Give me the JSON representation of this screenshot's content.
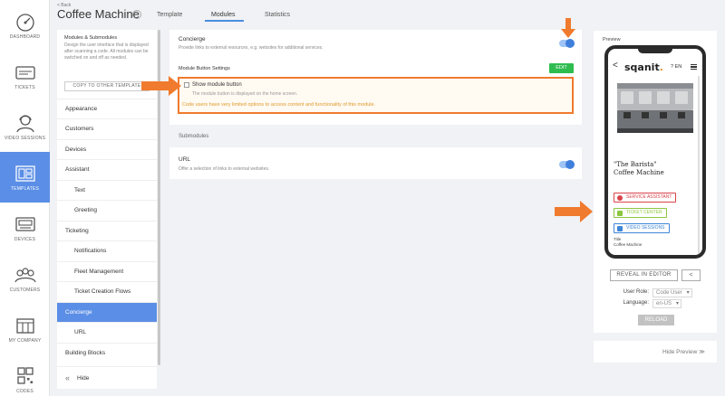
{
  "rail": [
    {
      "label": "DASHBOARD",
      "icon": "dashboard-icon"
    },
    {
      "label": "TICKETS",
      "icon": "tickets-icon"
    },
    {
      "label": "VIDEO SESSIONS",
      "icon": "video-sessions-icon"
    },
    {
      "label": "TEMPLATES",
      "icon": "templates-icon"
    },
    {
      "label": "DEVICES",
      "icon": "devices-icon"
    },
    {
      "label": "CUSTOMERS",
      "icon": "customers-icon"
    },
    {
      "label": "MY COMPANY",
      "icon": "company-icon"
    },
    {
      "label": "CODES",
      "icon": "codes-icon"
    }
  ],
  "header": {
    "back": "< Back",
    "title": "Coffee Machine",
    "info": "i",
    "tabs": [
      {
        "label": "Template"
      },
      {
        "label": "Modules"
      },
      {
        "label": "Statistics"
      }
    ]
  },
  "menu": {
    "heading": "Modules & Submodules",
    "description": "Design the user interface that is displayed after scanning a code. All modules can be switched on and off as needed.",
    "copy_button": "COPY TO OTHER TEMPLATE",
    "items": [
      {
        "label": "Appearance"
      },
      {
        "label": "Customers"
      },
      {
        "label": "Devices"
      },
      {
        "label": "Assistant"
      },
      {
        "label": "Text"
      },
      {
        "label": "Greeting"
      },
      {
        "label": "Ticketing"
      },
      {
        "label": "Notifications"
      },
      {
        "label": "Fleet Management"
      },
      {
        "label": "Ticket Creation Flows"
      },
      {
        "label": "Concierge"
      },
      {
        "label": "URL"
      },
      {
        "label": "Building Blocks"
      }
    ],
    "hide": "Hide"
  },
  "concierge": {
    "title": "Concierge",
    "description": "Provide links to external resources, e.g. websites for additional services.",
    "enabled": true,
    "settings_title": "Module Button Settings",
    "edit": "EDIT",
    "checkbox_label": "Show module button",
    "checkbox_sub": "The module button is displayed on the home screen.",
    "checked": false,
    "warning": "Code users have very limited options to access content and functionality of this module."
  },
  "submodules": {
    "heading": "Submodules",
    "url_title": "URL",
    "url_description": "Offer a selection of links to external websites.",
    "url_enabled": true
  },
  "preview": {
    "title": "Preview",
    "back": "<",
    "logo": "sqanit",
    "logo_dot": ".",
    "help": "? EN",
    "product_line1": "\"The Barista\"",
    "product_line2": "Coffee Machine",
    "buttons": [
      {
        "label": "SERVICE ASSISTANT",
        "color": "#d9434a"
      },
      {
        "label": "TICKET CENTER",
        "color": "#8cc63f"
      },
      {
        "label": "VIDEO SESSIONS",
        "color": "#3e86d6"
      }
    ],
    "meta_key": "Title",
    "meta_value": "Coffee Machine",
    "reveal": "REVEAL IN EDITOR",
    "share": "<",
    "role_label": "User Role:",
    "role_value": "Code User",
    "lang_label": "Language:",
    "lang_value": "en-US",
    "reload": "RELOAD"
  },
  "hide_preview": "Hide Preview ≫",
  "colors": {
    "accent": "#5b8ee6",
    "highlight": "#f07a2d",
    "edit": "#2fbd4f",
    "warning": "#e09a2c"
  }
}
